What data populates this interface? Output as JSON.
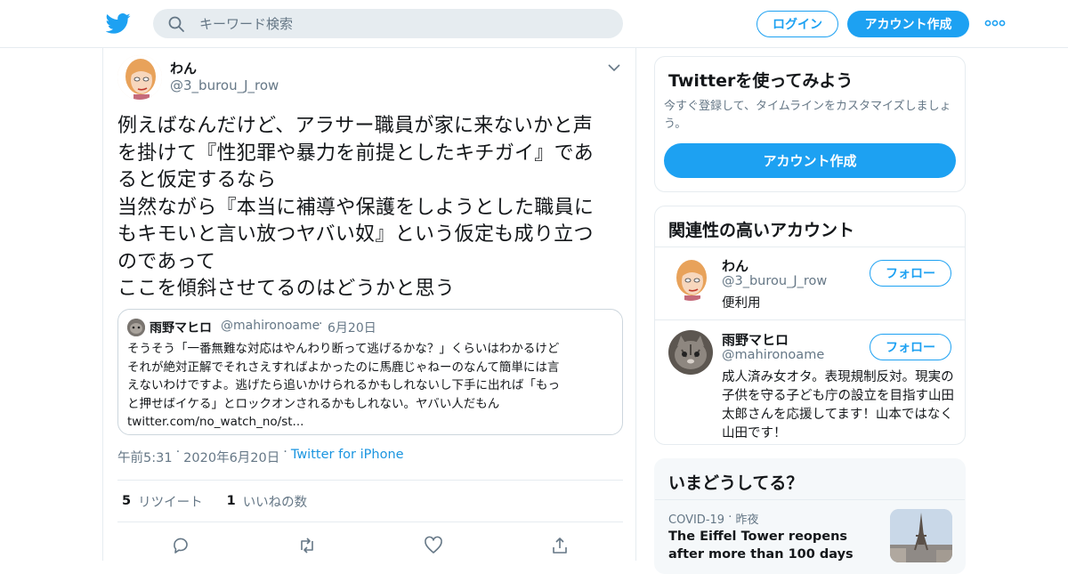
{
  "header": {
    "search_placeholder": "キーワード検索",
    "login_label": "ログイン",
    "signup_label": "アカウント作成"
  },
  "tweet": {
    "author_name": "わん",
    "author_handle": "@3_burou_J_row",
    "text": "例えばなんだけど、アラサー職員が家に来ないかと声\nを掛けて『性犯罪や暴力を前提としたキチガイ』であ\nると仮定するなら\n当然ながら『本当に補導や保護をしようとした職員に\nもキモいと言い放つヤバい奴』という仮定も成り立つ\nのであって\nここを傾斜させてるのはどうかと思う",
    "quote": {
      "name": "雨野マヒロ",
      "handle": "@mahironoame",
      "dot": "·",
      "date": "6月20日",
      "text": "そうそう「一番無難な対応はやんわり断って逃げるかな？」くらいはわかるけど\nそれが絶対正解でそれさえすればよかったのに馬鹿じゃねーのなんて簡単には言\nえないわけですよ。逃げたら追いかけられるかもしれないし下手に出れば「もっ\nと押せばイケる」とロックオンされるかもしれない。ヤバい人だもん\ntwitter.com/no_watch_no/st..."
    },
    "time": "午前5:31",
    "date": "2020年6月20日",
    "source": "Twitter for iPhone",
    "dot": "·",
    "retweet_count": "5",
    "retweet_label": "リツイート",
    "like_count": "1",
    "like_label": "いいねの数"
  },
  "sidebar": {
    "signup_card": {
      "title": "Twitterを使ってみよう",
      "subtitle": "今すぐ登録して、タイムラインをカスタマイズしましょ\nう。",
      "button": "アカウント作成"
    },
    "related": {
      "title": "関連性の高いアカウント",
      "accounts": [
        {
          "name": "わん",
          "handle": "@3_burou_J_row",
          "bio": "便利用",
          "follow": "フォロー"
        },
        {
          "name": "雨野マヒロ",
          "handle": "@mahironoame",
          "bio": "成人済み女オタ。表現規制反対。現実の子供を守る子ども庁の設立を目指す山田太郎さんを応援してます！山本ではなく山田です！",
          "follow": "フォロー"
        }
      ]
    },
    "trends": {
      "title": "いまどうしてる？",
      "item": {
        "category": "COVID-19",
        "dot": "·",
        "time": "昨夜",
        "title": "The Eiffel Tower reopens after more than 100 days"
      }
    }
  },
  "colors": {
    "accent": "#1da1f2",
    "secondary_text": "#657786",
    "border": "#e6ecf0"
  }
}
